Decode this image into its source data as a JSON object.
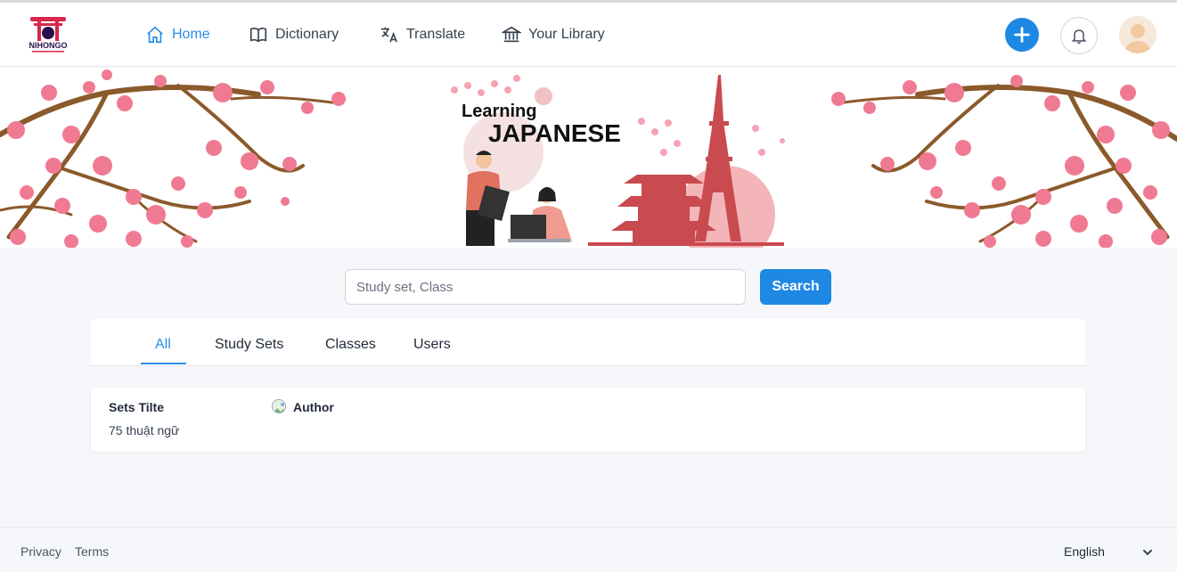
{
  "header": {
    "logo_text": "NIHONGO",
    "nav": [
      {
        "label": "Home",
        "icon": "home-icon"
      },
      {
        "label": "Dictionary",
        "icon": "book-icon"
      },
      {
        "label": "Translate",
        "icon": "translate-icon"
      },
      {
        "label": "Your Library",
        "icon": "library-icon"
      }
    ],
    "actions": {
      "create": "plus-icon",
      "notifications": "bell-icon",
      "profile": "avatar"
    }
  },
  "banner": {
    "line1": "Learning",
    "line2": "JAPANESE"
  },
  "search": {
    "placeholder": "Study set, Class",
    "button_label": "Search"
  },
  "tabs": [
    {
      "label": "All",
      "active": true
    },
    {
      "label": "Study Sets",
      "active": false
    },
    {
      "label": "Classes",
      "active": false
    },
    {
      "label": "Users",
      "active": false
    }
  ],
  "results": [
    {
      "title": "Sets Tilte",
      "count": "75 thuật ngữ",
      "author": "Author"
    }
  ],
  "footer": {
    "privacy": "Privacy",
    "terms": "Terms",
    "language": "English"
  },
  "colors": {
    "accent": "#1e88e5",
    "active_text": "#2b8ce6",
    "blossom": "#f07a92",
    "branch": "#8b5a2b",
    "tower": "#c94a4f"
  }
}
